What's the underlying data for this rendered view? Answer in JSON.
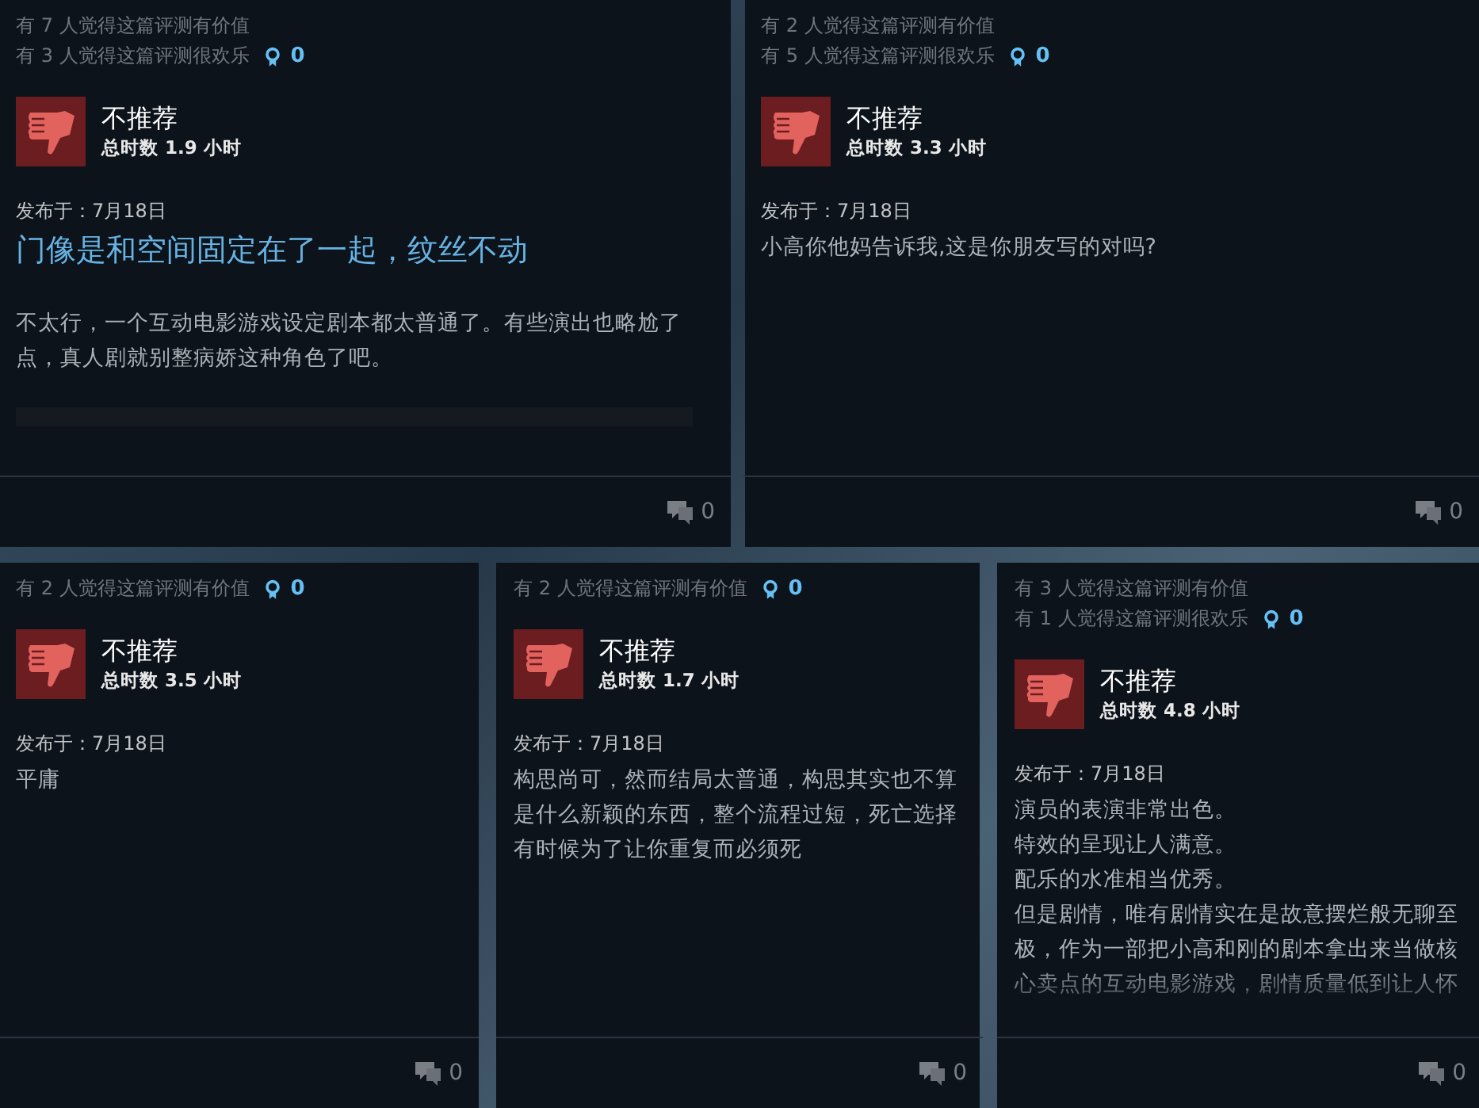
{
  "reviews": [
    {
      "helpful": [
        "有 7 人觉得这篇评测有价值",
        "有 3 人觉得这篇评测很欢乐"
      ],
      "awards": "0",
      "verdict": "不推荐",
      "recommended": false,
      "hours": "总时数 1.9 小时",
      "posted": "发布于：7月18日",
      "body": [
        {
          "kind": "heading",
          "text": "门像是和空间固定在了一起，纹丝不动"
        },
        {
          "kind": "text",
          "text": "不太行，一个互动电影游戏设定剧本都太普通了。有些演出也略尬了点，真人剧就别整病娇这种角色了吧。"
        },
        {
          "kind": "bar"
        }
      ],
      "faded": false,
      "comments": "0"
    },
    {
      "helpful": [
        "有 2 人觉得这篇评测有价值",
        "有 5 人觉得这篇评测很欢乐"
      ],
      "awards": "0",
      "verdict": "不推荐",
      "recommended": false,
      "hours": "总时数 3.3 小时",
      "posted": "发布于：7月18日",
      "body": [
        {
          "kind": "text",
          "text": "小高你他妈告诉我,这是你朋友写的对吗?"
        }
      ],
      "faded": false,
      "comments": "0"
    },
    {
      "helpful": [
        "有 2 人觉得这篇评测有价值"
      ],
      "awards": "0",
      "verdict": "不推荐",
      "recommended": false,
      "hours": "总时数 3.5 小时",
      "posted": "发布于：7月18日",
      "body": [
        {
          "kind": "text",
          "text": "平庸"
        }
      ],
      "faded": false,
      "comments": "0"
    },
    {
      "helpful": [
        "有 2 人觉得这篇评测有价值"
      ],
      "awards": "0",
      "verdict": "不推荐",
      "recommended": false,
      "hours": "总时数 1.7 小时",
      "posted": "发布于：7月18日",
      "body": [
        {
          "kind": "text",
          "text": "构思尚可，然而结局太普通，构思其实也不算是什么新颖的东西，整个流程过短，死亡选择有时候为了让你重复而必须死"
        }
      ],
      "faded": false,
      "comments": "0"
    },
    {
      "helpful": [
        "有 3 人觉得这篇评测有价值",
        "有 1 人觉得这篇评测很欢乐"
      ],
      "awards": "0",
      "verdict": "不推荐",
      "recommended": false,
      "hours": "总时数 4.8 小时",
      "posted": "发布于：7月18日",
      "body": [
        {
          "kind": "text",
          "text": "演员的表演非常出色。"
        },
        {
          "kind": "text",
          "text": "特效的呈现让人满意。"
        },
        {
          "kind": "text",
          "text": "配乐的水准相当优秀。"
        },
        {
          "kind": "text",
          "text": "但是剧情，唯有剧情实在是故意摆烂般无聊至极，作为一部把小高和刚的剧本拿出来当做核心卖点的互动电影游戏，剧情质量低到让人怀"
        }
      ],
      "faded": true,
      "comments": "0"
    }
  ]
}
